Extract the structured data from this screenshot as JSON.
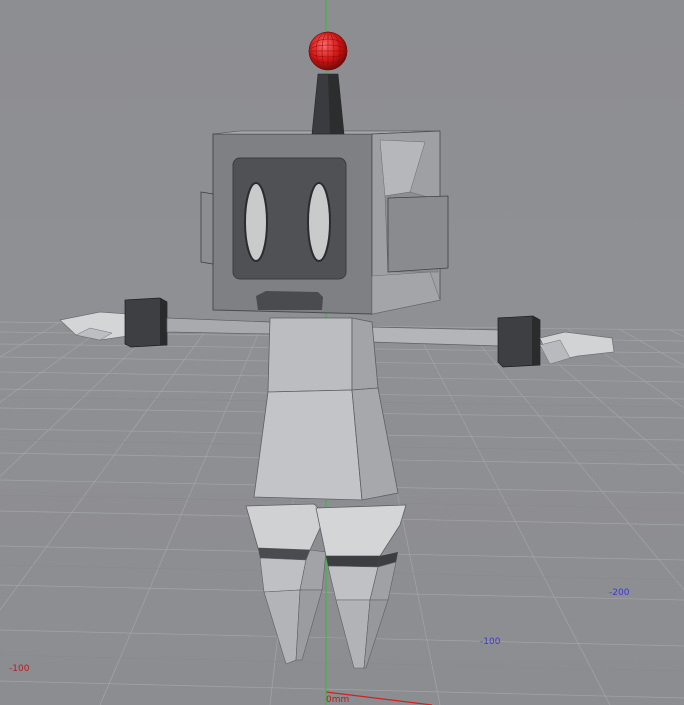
{
  "viewport": {
    "grid_labels": {
      "neg_x": "-100",
      "z_100": "-100",
      "z_200": "-200",
      "origin": "0mm"
    },
    "colors": {
      "background": "#8e8f93",
      "grid_line": "#9c9da1",
      "x_axis": "#d42020",
      "y_axis": "#2fbf2f",
      "label_red": "#b81c1c",
      "label_blue": "#3a3ad0",
      "antenna_ball": "#d41616"
    },
    "scene_objects": [
      "robot-model",
      "ground-grid"
    ]
  }
}
